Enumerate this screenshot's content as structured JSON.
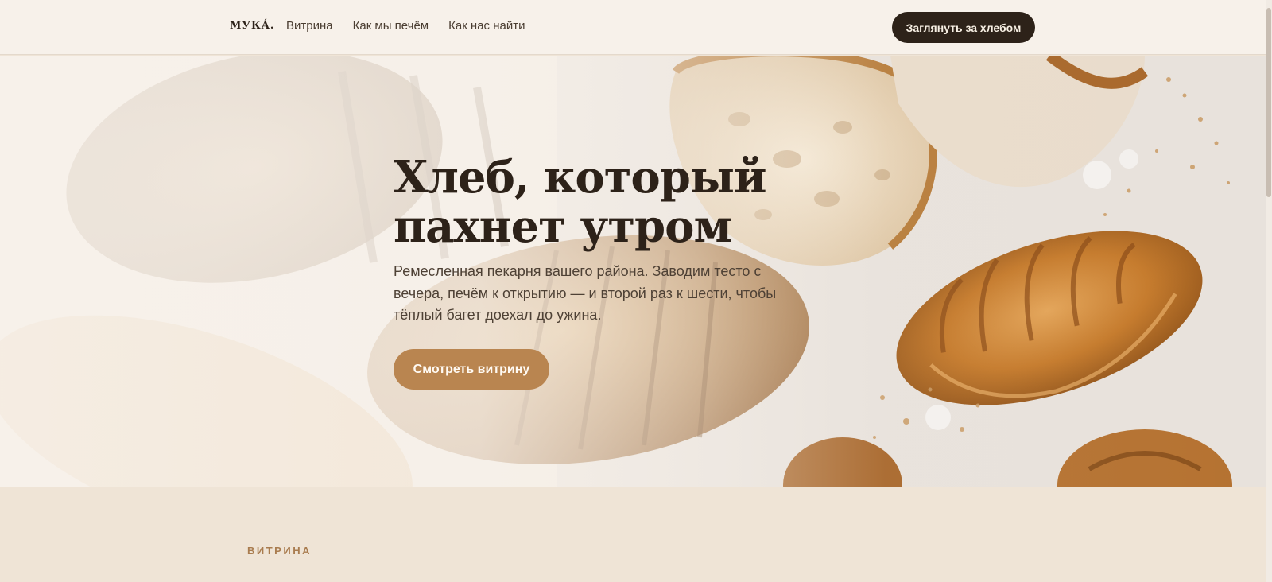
{
  "header": {
    "logo": "МУКÁ.",
    "nav": [
      "Витрина",
      "Как мы печём",
      "Как нас найти"
    ],
    "cta": "Заглянуть за хлебом"
  },
  "hero": {
    "title_line1": "Хлеб, который",
    "title_line2": "пахнет утром",
    "text": "Ремесленная пекарня вашего района. Заводим тесто с вечера, печём к открытию — и второй раз к шести, чтобы тёплый багет доехал до ужина.",
    "cta": "Смотреть витрину"
  },
  "section": {
    "eyebrow": "ВИТРИНА"
  },
  "colors": {
    "dark": "#2d2219",
    "accent": "#b98550",
    "header_bg": "#f7f1ea",
    "section_bg": "#efe4d6"
  },
  "icons": [
    "hero-bakery-photo"
  ]
}
